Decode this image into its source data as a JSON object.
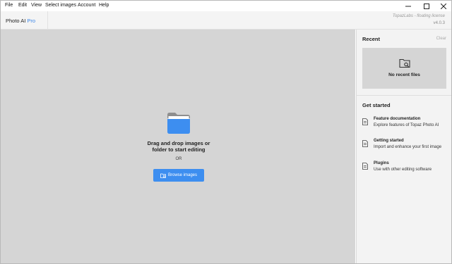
{
  "menu": {
    "items": [
      "File",
      "Edit",
      "View",
      "Select images",
      "Account",
      "Help"
    ]
  },
  "window_controls": {
    "minimize": "—",
    "maximize": "☐",
    "close": "✕"
  },
  "header": {
    "app_name": "Photo AI",
    "app_edition": "Pro",
    "license": "TopazLabs - floating license",
    "version": "v4.0.3"
  },
  "dropzone": {
    "line1": "Drag and drop images or",
    "line2": "folder to start editing",
    "or_text": "OR",
    "browse_label": "Browse images"
  },
  "sidebar": {
    "recent_title": "Recent",
    "clear_label": "Clear",
    "no_recent": "No recent files",
    "get_started_title": "Get started",
    "items": [
      {
        "title": "Feature documentation",
        "subtitle": "Explore features of Topaz Photo AI",
        "icon": "document-icon"
      },
      {
        "title": "Getting started",
        "subtitle": "Import and enhance your first image",
        "icon": "document-icon"
      },
      {
        "title": "Plugins",
        "subtitle": "Use with other editing software",
        "icon": "document-icon"
      }
    ]
  },
  "colors": {
    "accent": "#3d8ef0",
    "dropzone_bg": "#d5d5d5",
    "sidebar_bg": "#f3f3f3"
  }
}
